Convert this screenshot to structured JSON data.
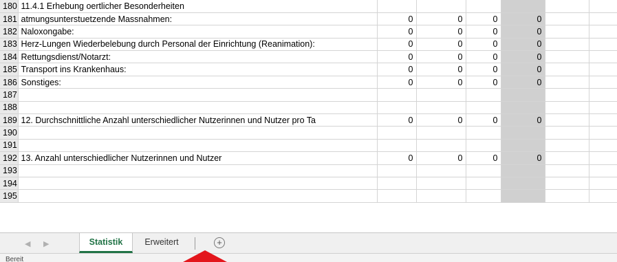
{
  "rows": [
    {
      "num": "180",
      "label": "11.4.1 Erhebung oertlicher Besonderheiten",
      "values": [
        "",
        "",
        "",
        ""
      ]
    },
    {
      "num": "181",
      "label": "atmungsunterstuetzende Massnahmen:",
      "values": [
        "0",
        "0",
        "0",
        "0"
      ]
    },
    {
      "num": "182",
      "label": "Naloxongabe:",
      "values": [
        "0",
        "0",
        "0",
        "0"
      ]
    },
    {
      "num": "183",
      "label": "Herz-Lungen Wiederbelebung durch Personal der Einrichtung (Reanimation):",
      "values": [
        "0",
        "0",
        "0",
        "0"
      ]
    },
    {
      "num": "184",
      "label": "Rettungsdienst/Notarzt:",
      "values": [
        "0",
        "0",
        "0",
        "0"
      ]
    },
    {
      "num": "185",
      "label": "Transport ins Krankenhaus:",
      "values": [
        "0",
        "0",
        "0",
        "0"
      ]
    },
    {
      "num": "186",
      "label": "Sonstiges:",
      "values": [
        "0",
        "0",
        "0",
        "0"
      ]
    },
    {
      "num": "187",
      "label": "",
      "values": [
        "",
        "",
        "",
        ""
      ]
    },
    {
      "num": "188",
      "label": "",
      "values": [
        "",
        "",
        "",
        ""
      ]
    },
    {
      "num": "189",
      "label": "12. Durchschnittliche Anzahl unterschiedlicher Nutzerinnen und Nutzer pro Ta",
      "values": [
        "0",
        "0",
        "0",
        "0"
      ]
    },
    {
      "num": "190",
      "label": "",
      "values": [
        "",
        "",
        "",
        ""
      ]
    },
    {
      "num": "191",
      "label": "",
      "values": [
        "",
        "",
        "",
        ""
      ]
    },
    {
      "num": "192",
      "label": "13. Anzahl unterschiedlicher Nutzerinnen und Nutzer",
      "values": [
        "0",
        "0",
        "0",
        "0"
      ]
    },
    {
      "num": "193",
      "label": "",
      "values": [
        "",
        "",
        "",
        ""
      ]
    },
    {
      "num": "194",
      "label": "",
      "values": [
        "",
        "",
        "",
        ""
      ]
    },
    {
      "num": "195",
      "label": "",
      "values": [
        "",
        "",
        "",
        ""
      ]
    }
  ],
  "tabbar": {
    "prev_icon": "triangle-left-icon",
    "next_icon": "triangle-right-icon",
    "tabs": [
      {
        "label": "Statistik",
        "active": true
      },
      {
        "label": "Erweitert",
        "active": false
      }
    ],
    "add_icon": "plus-circle-icon"
  },
  "status": {
    "text": "Bereit"
  },
  "colors": {
    "accent": "#217346",
    "shaded_column": "#d0d0d0",
    "marker": "#e3161c"
  }
}
